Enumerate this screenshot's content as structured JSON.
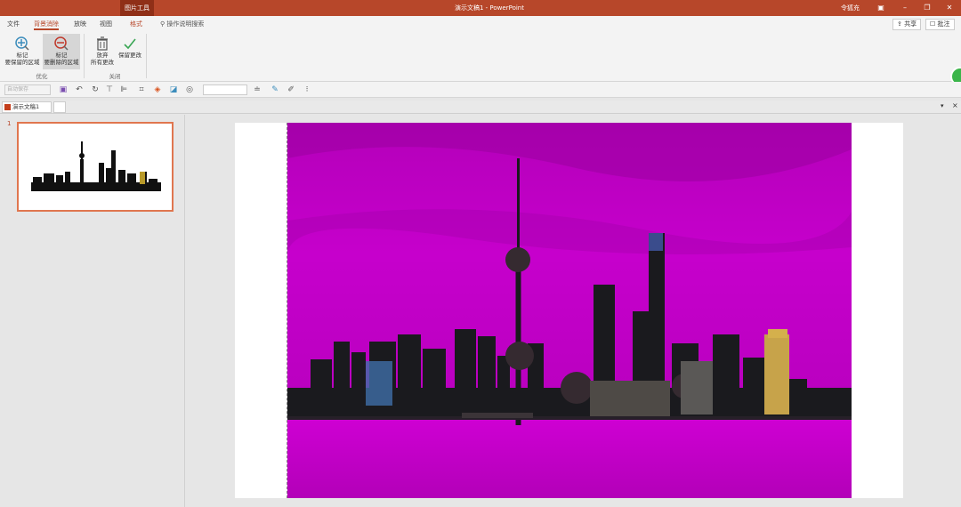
{
  "titlebar": {
    "context_tab": "图片工具",
    "title": "演示文稿1  -  PowerPoint",
    "user": "令狐充",
    "ribbon_display_icon": "ribbon-display-icon",
    "min_icon": "minimize-icon",
    "restore_icon": "restore-icon",
    "close_icon": "close-icon"
  },
  "tabs": {
    "file": "文件",
    "background_removal": "背景消除",
    "slideshow": "放映",
    "view": "视图",
    "format": "格式",
    "search": "操作说明搜索",
    "share": "共享",
    "comments": "批注"
  },
  "ribbon": {
    "mark_keep_l1": "标记",
    "mark_keep_l2": "要保留的区域",
    "mark_remove_l1": "标记",
    "mark_remove_l2": "要删除的区域",
    "discard_l1": "放弃",
    "discard_l2": "所有更改",
    "keep_changes": "保留更改",
    "group_refine": "优化",
    "group_close": "关闭"
  },
  "qat": {
    "font_placeholder": "自动保存"
  },
  "doctabs": {
    "doc_name": "演示文稿1",
    "close": "×"
  },
  "slides": {
    "number": "1"
  },
  "colors": {
    "accent": "#b7472a",
    "magenta_bg": "#c000c8",
    "thumb_border": "#e0764f"
  }
}
